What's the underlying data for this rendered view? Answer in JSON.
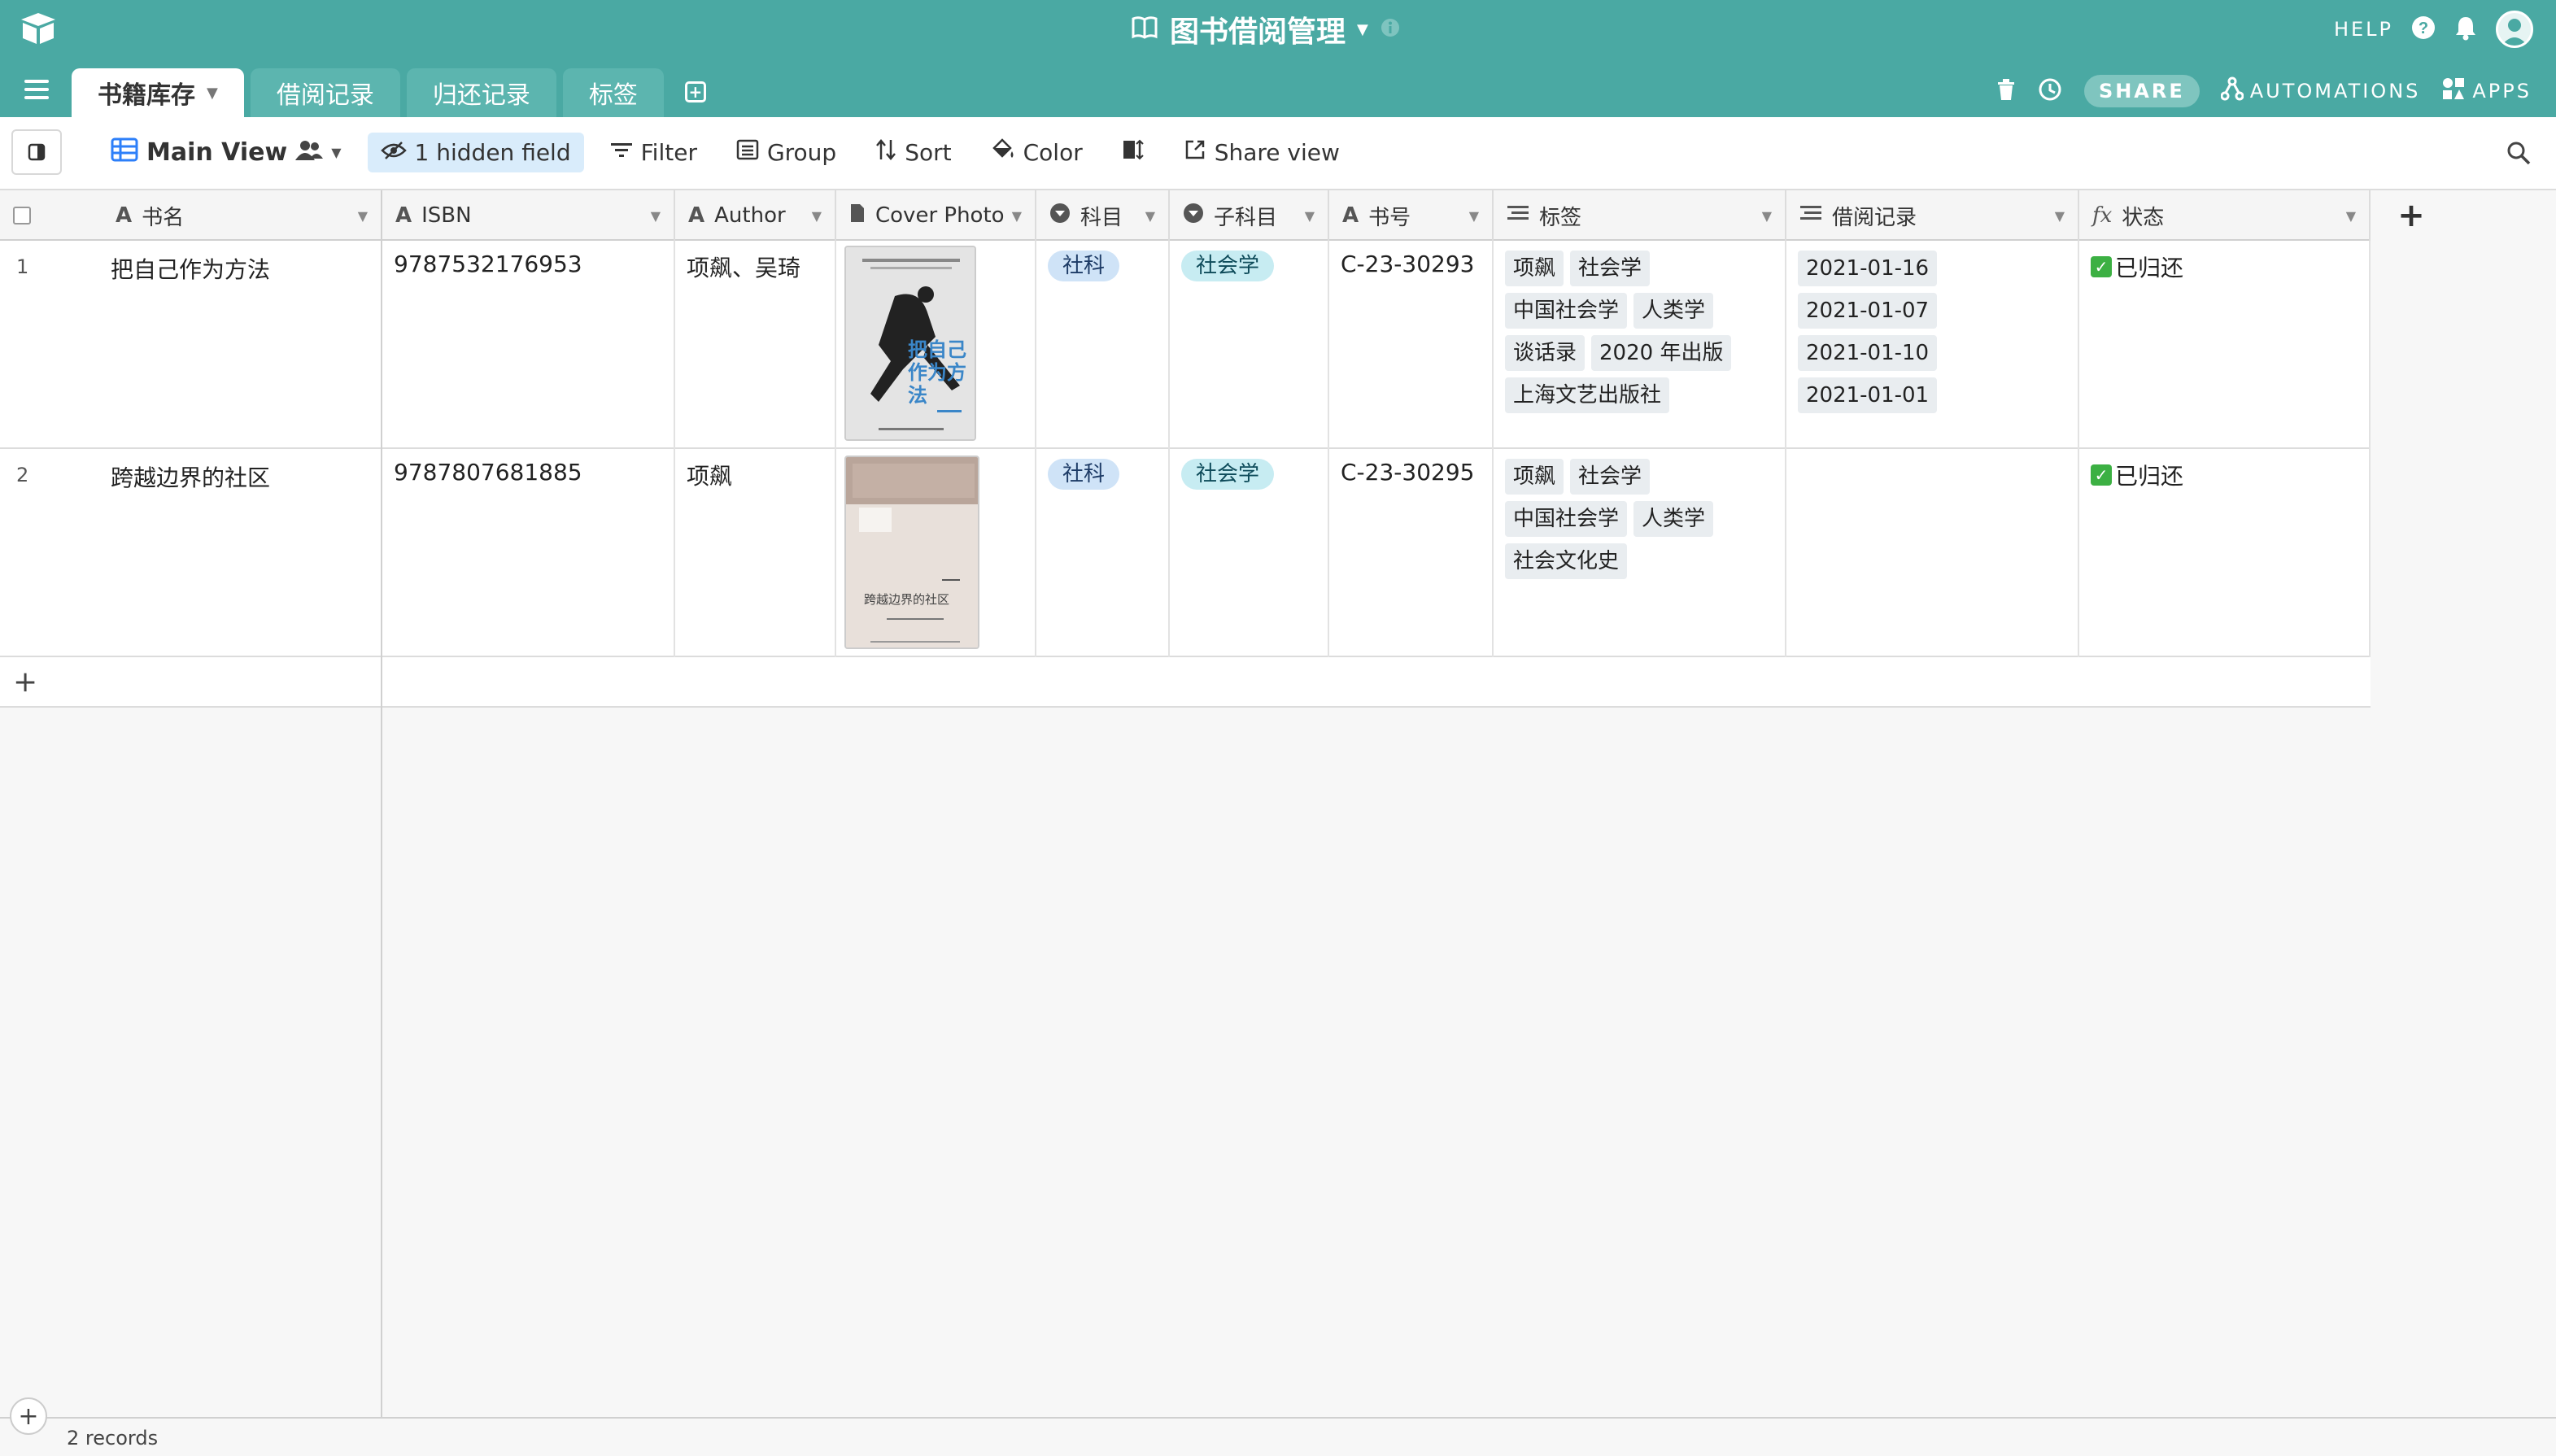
{
  "app": {
    "base_title": "图书借阅管理",
    "help_label": "HELP"
  },
  "tabs": [
    {
      "label": "书籍库存",
      "active": true
    },
    {
      "label": "借阅记录",
      "active": false
    },
    {
      "label": "归还记录",
      "active": false
    },
    {
      "label": "标签",
      "active": false
    }
  ],
  "tab_right": {
    "share_label": "SHARE",
    "automations_label": "AUTOMATIONS",
    "apps_label": "APPS"
  },
  "toolbar": {
    "view_name": "Main View",
    "hidden_fields_label": "1 hidden field",
    "filter_label": "Filter",
    "group_label": "Group",
    "sort_label": "Sort",
    "color_label": "Color",
    "share_view_label": "Share view"
  },
  "columns": [
    {
      "name": "书名",
      "icon": "text-icon"
    },
    {
      "name": "ISBN",
      "icon": "text-icon"
    },
    {
      "name": "Author",
      "icon": "text-icon"
    },
    {
      "name": "Cover Photo",
      "icon": "attachment-icon"
    },
    {
      "name": "科目",
      "icon": "single-select-icon"
    },
    {
      "name": "子科目",
      "icon": "single-select-icon"
    },
    {
      "name": "书号",
      "icon": "text-icon"
    },
    {
      "name": "标签",
      "icon": "linked-record-icon"
    },
    {
      "name": "借阅记录",
      "icon": "linked-record-icon"
    },
    {
      "name": "状态",
      "icon": "formula-icon"
    }
  ],
  "rows": [
    {
      "num": "1",
      "title": "把自己作为方法",
      "isbn": "9787532176953",
      "author": "项飙、吴琦",
      "subject": "社科",
      "subsubject": "社会学",
      "book_no": "C-23-30293",
      "tags": [
        "项飙",
        "社会学",
        "中国社会学",
        "人类学",
        "谈话录",
        "2020 年出版",
        "上海文艺出版社"
      ],
      "borrow_records": [
        "2021-01-16",
        "2021-01-07",
        "2021-01-10",
        "2021-01-01"
      ],
      "status": "已归还",
      "cover_text": "把自己作为方法"
    },
    {
      "num": "2",
      "title": "跨越边界的社区",
      "isbn": "9787807681885",
      "author": "项飙",
      "subject": "社科",
      "subsubject": "社会学",
      "book_no": "C-23-30295",
      "tags": [
        "项飙",
        "社会学",
        "中国社会学",
        "人类学",
        "社会文化史"
      ],
      "borrow_records": [],
      "status": "已归还",
      "cover_text": "跨越边界的社区"
    }
  ],
  "footer": {
    "records_label": "2 records"
  },
  "colors": {
    "topbar": "#4aa9a3",
    "active_tab": "#ffffff",
    "subject_pill": "#cfe3f7",
    "subsubject_pill": "#c7ecf2",
    "status_check": "#3cb043"
  }
}
